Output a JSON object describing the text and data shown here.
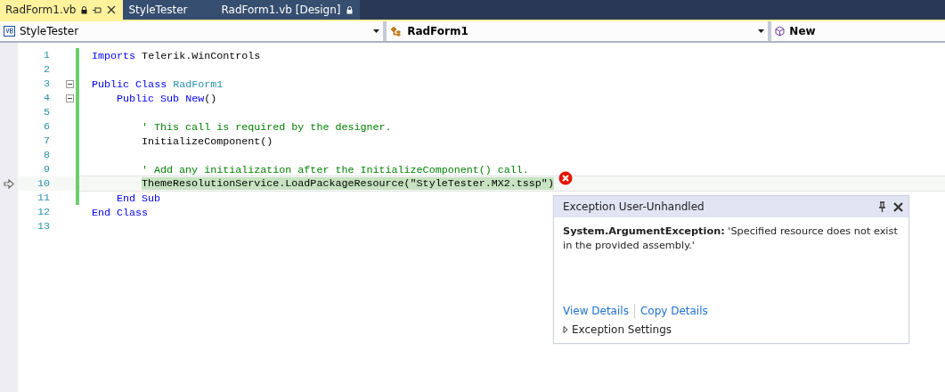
{
  "tabs": [
    {
      "label": "RadForm1.vb",
      "selected": true,
      "locked": true
    },
    {
      "label": "StyleTester",
      "selected": false,
      "locked": false
    },
    {
      "label": "RadForm1.vb [Design]",
      "selected": false,
      "locked": true
    }
  ],
  "nav_bar": {
    "project": "StyleTester",
    "class": "RadForm1",
    "member": "New"
  },
  "lines": [
    {
      "number": "1",
      "changed": true,
      "current": false,
      "collapsible": false,
      "tokens": [
        {
          "kind": "keyword",
          "text": "Imports"
        },
        {
          "kind": "plain",
          "text": " Telerik.WinControls"
        }
      ]
    },
    {
      "number": "2",
      "changed": true,
      "current": false,
      "collapsible": false
    },
    {
      "number": "3",
      "changed": true,
      "current": false,
      "collapsible": true,
      "tokens": [
        {
          "kind": "keyword",
          "text": "Public Class"
        },
        {
          "kind": "type",
          "text": " RadForm1"
        }
      ],
      "children": [
        {
          "number": "4",
          "changed": true,
          "current": false,
          "collapsible": true,
          "tokens": [
            {
              "kind": "keyword",
              "text": "Public Sub New"
            },
            {
              "kind": "plain",
              "text": "()"
            }
          ],
          "children": [
            {
              "number": "5",
              "changed": true,
              "current": false,
              "collapsible": false
            },
            {
              "number": "6",
              "changed": true,
              "current": false,
              "collapsible": false,
              "tokens": [
                {
                  "kind": "comment",
                  "text": "' This call is required by the designer."
                }
              ]
            },
            {
              "number": "7",
              "changed": true,
              "current": false,
              "collapsible": false,
              "tokens": [
                {
                  "kind": "plain",
                  "text": "InitializeComponent()"
                }
              ]
            },
            {
              "number": "8",
              "changed": true,
              "current": false,
              "collapsible": false
            },
            {
              "number": "9",
              "changed": true,
              "current": false,
              "collapsible": false,
              "tokens": [
                {
                  "kind": "comment",
                  "text": "' Add any initialization after the InitializeComponent() call."
                }
              ]
            },
            {
              "number": "10",
              "changed": true,
              "current": true,
              "collapsible": false,
              "tokens": [
                {
                  "kind": "highlight",
                  "text": "ThemeResolutionService.LoadPackageResource(\"StyleTester.MX2.tssp\")"
                }
              ]
            }
          ]
        },
        {
          "number": "11",
          "changed": true,
          "current": false,
          "collapsible": false,
          "tokens": [
            {
              "kind": "keyword",
              "text": "End Sub"
            }
          ]
        }
      ]
    },
    {
      "number": "12",
      "changed": false,
      "current": false,
      "collapsible": false,
      "tokens": [
        {
          "kind": "keyword",
          "text": "End Class"
        }
      ]
    },
    {
      "number": "13",
      "changed": false,
      "current": false,
      "collapsible": false
    }
  ],
  "exception_popup": {
    "title": "Exception User-Unhandled",
    "message": "**System.ArgumentException:** 'Specified resource does not exist in the provided assembly.'",
    "links": [
      "View Details",
      "Copy Details"
    ],
    "settings": {
      "label": "Exception Settings",
      "expanded": false
    }
  }
}
